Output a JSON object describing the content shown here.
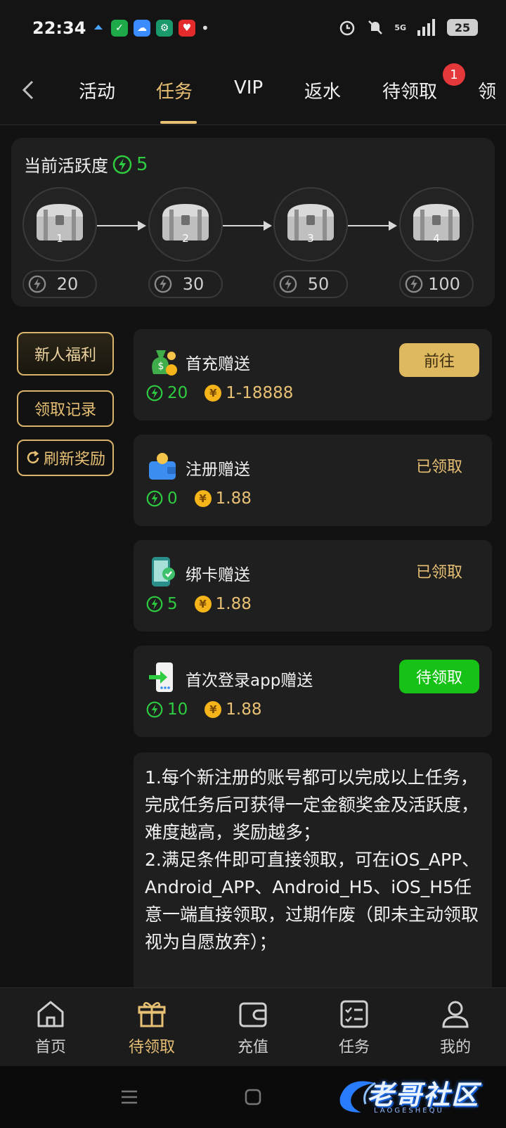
{
  "status_bar": {
    "time": "22:34",
    "network": "5G",
    "battery": "25"
  },
  "tabs": {
    "items": [
      "活动",
      "任务",
      "VIP",
      "返水",
      "待领取",
      "领"
    ],
    "active": "任务",
    "badge": "1"
  },
  "activity": {
    "title": "当前活跃度",
    "value": "5",
    "chests": [
      {
        "num": "1",
        "points": "20"
      },
      {
        "num": "2",
        "points": "30"
      },
      {
        "num": "3",
        "points": "50"
      },
      {
        "num": "4",
        "points": "100"
      }
    ]
  },
  "side_buttons": {
    "newcomer": "新人福利",
    "records": "领取记录",
    "refresh": "刷新奖励"
  },
  "tasks": [
    {
      "title": "首充赠送",
      "activity": "20",
      "reward": "1-18888",
      "action": "前往",
      "state": "go"
    },
    {
      "title": "注册赠送",
      "activity": "0",
      "reward": "1.88",
      "action": "已领取",
      "state": "done"
    },
    {
      "title": "绑卡赠送",
      "activity": "5",
      "reward": "1.88",
      "action": "已领取",
      "state": "done"
    },
    {
      "title": "首次登录app赠送",
      "activity": "10",
      "reward": "1.88",
      "action": "待领取",
      "state": "claim"
    }
  ],
  "coin_symbol": "¥",
  "rules": {
    "text": "1.每个新注册的账号都可以完成以上任务，完成任务后可获得一定金额奖金及活跃度，难度越高，奖励越多；\n2.满足条件即可直接领取，可在iOS_APP、Android_APP、Android_H5、iOS_H5任意一端直接领取，过期作废（即未主动领取视为自愿放弃）；"
  },
  "bottom_nav": {
    "items": [
      {
        "label": "首页",
        "icon": "home-icon"
      },
      {
        "label": "待领取",
        "icon": "gift-icon"
      },
      {
        "label": "充值",
        "icon": "wallet-icon"
      },
      {
        "label": "任务",
        "icon": "task-list-icon"
      },
      {
        "label": "我的",
        "icon": "profile-icon"
      }
    ],
    "active": "待领取"
  },
  "watermark": {
    "text": "老哥社区",
    "sub": "LAOGESHEQU"
  },
  "colors": {
    "accent_gold": "#e7c074",
    "activity_green": "#2ecc40",
    "claim_green": "#17c217",
    "background": "#121212",
    "card": "#1f1f1f"
  }
}
